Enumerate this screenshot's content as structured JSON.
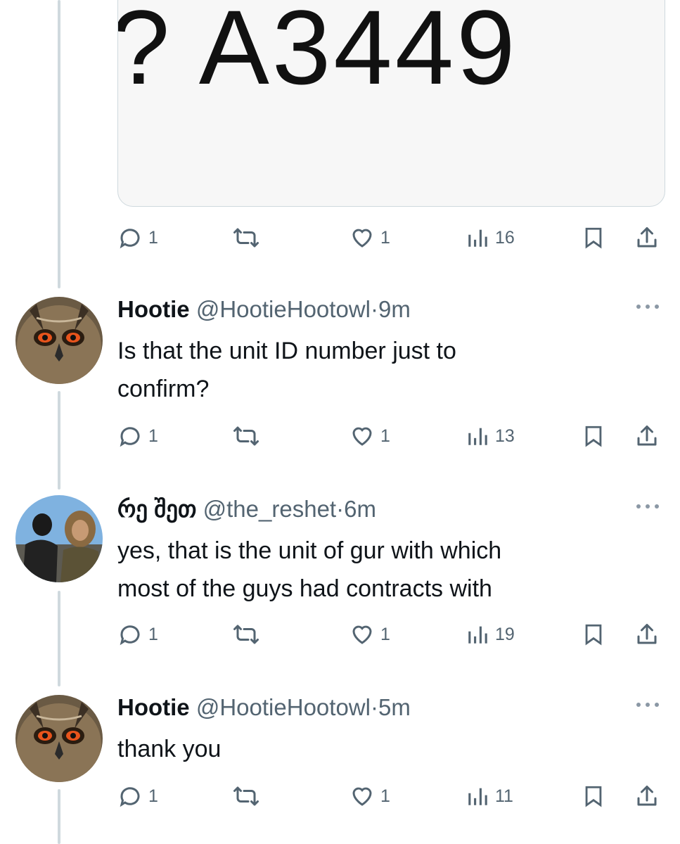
{
  "media": {
    "plate_text": "? A3449"
  },
  "tweets": [
    {
      "stats": {
        "replies": "1",
        "likes": "1",
        "views": "16"
      }
    },
    {
      "name": "Hootie",
      "handle": "@HootieHootowl",
      "time": "9m",
      "text_lines": [
        "Is that the unit ID number just to",
        "confirm?"
      ],
      "stats": {
        "replies": "1",
        "likes": "1",
        "views": "13"
      }
    },
    {
      "name": "რე შეთ",
      "handle": "@the_reshet",
      "time": "6m",
      "text_lines": [
        "yes, that is the unit of gur with which",
        "most of the guys had contracts with"
      ],
      "stats": {
        "replies": "1",
        "likes": "1",
        "views": "19"
      }
    },
    {
      "name": "Hootie",
      "handle": "@HootieHootowl",
      "time": "5m",
      "text_lines": [
        "thank you"
      ],
      "stats": {
        "replies": "1",
        "likes": "1",
        "views": "11"
      }
    }
  ],
  "colors": {
    "icon": "#536471",
    "thread_line": "#cfd9de",
    "text": "#0f1419"
  }
}
